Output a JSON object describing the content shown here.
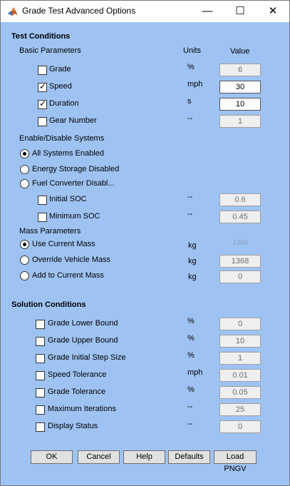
{
  "window": {
    "title": "Grade Test Advanced Options",
    "minimize": "—",
    "maximize": "☐",
    "close": "✕"
  },
  "test_conditions": {
    "heading": "Test Conditions",
    "basic_heading": "Basic Parameters",
    "units_header": "Units",
    "value_header": "Value",
    "params": [
      {
        "label": "Grade",
        "checked": false,
        "unit": "%",
        "value": "6"
      },
      {
        "label": "Speed",
        "checked": true,
        "unit": "mph",
        "value": "30"
      },
      {
        "label": "Duration",
        "checked": true,
        "unit": "s",
        "value": "10"
      },
      {
        "label": "Gear Number",
        "checked": false,
        "unit": "--",
        "value": "1"
      }
    ],
    "systems_heading": "Enable/Disable Systems",
    "systems": [
      {
        "label": "All Systems Enabled",
        "selected": true
      },
      {
        "label": "Energy Storage Disabled",
        "selected": false
      },
      {
        "label": "Fuel Converter Disabl...",
        "selected": false
      }
    ],
    "soc": [
      {
        "label": "Initial SOC",
        "checked": false,
        "unit": "--",
        "value": "0.6"
      },
      {
        "label": "Minimum SOC",
        "checked": false,
        "unit": "--",
        "value": "0.45"
      }
    ],
    "mass_heading": "Mass Parameters",
    "mass": [
      {
        "label": "Use Current Mass",
        "selected": true,
        "unit": "kg",
        "value": "1368"
      },
      {
        "label": "Override Vehicle Mass",
        "selected": false,
        "unit": "kg",
        "value": "1368"
      },
      {
        "label": "Add to Current Mass",
        "selected": false,
        "unit": "kg",
        "value": "0"
      }
    ]
  },
  "solution_conditions": {
    "heading": "Solution Conditions",
    "params": [
      {
        "label": "Grade Lower Bound",
        "checked": false,
        "unit": "%",
        "value": "0"
      },
      {
        "label": "Grade Upper Bound",
        "checked": false,
        "unit": "%",
        "value": "10"
      },
      {
        "label": "Grade Initial Step Size",
        "checked": false,
        "unit": "%",
        "value": "1"
      },
      {
        "label": "Speed Tolerance",
        "checked": false,
        "unit": "mph",
        "value": "0.01"
      },
      {
        "label": "Grade Tolerance",
        "checked": false,
        "unit": "%",
        "value": "0.05"
      },
      {
        "label": "Maximum Iterations",
        "checked": false,
        "unit": "--",
        "value": "25"
      },
      {
        "label": "Display Status",
        "checked": false,
        "unit": "--",
        "value": "0"
      }
    ]
  },
  "buttons": {
    "ok": "OK",
    "cancel": "Cancel",
    "help": "Help",
    "defaults": "Defaults",
    "load_pngv": "Load PNGV"
  },
  "colors": {
    "panel_bg": "#9ec3f3",
    "titlebar_bg": "#ffffff",
    "field_disabled": "#efefef"
  },
  "icons": {
    "app": "matlab-icon",
    "check": "checkmark-icon"
  }
}
